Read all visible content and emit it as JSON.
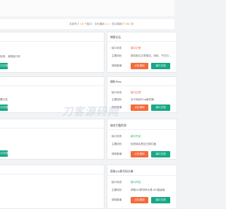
{
  "summary": {
    "prefix": "共发布了",
    "a": "16",
    "mid1": "个接口 · 今日调用",
    "b": "1.2",
    "mid2": "· 总共调用了",
    "c": "462",
    "suffix": "次"
  },
  "watermark": "刀客源码网",
  "labels": {
    "status": "接口状态",
    "use": "主要用处",
    "call": "调用渠道"
  },
  "buttons": {
    "apply": "点击调用",
    "doc": "接口文档"
  },
  "left_texts": {
    "t1": "检测，消费接口来",
    "t2": "署已送"
  },
  "cards": [
    {
      "title": "博客论坛",
      "status": "接口正常",
      "use": "提供各位文章推送、收权、节日日..."
    },
    {
      "title": "随机Ping",
      "status": "接口正常",
      "use": "对于网站Ping服务器"
    },
    {
      "title": "域名拦截检测",
      "status": "接口开启",
      "use": "检查域名是否已被拦截"
    },
    {
      "title": "获取QQ群号码头像",
      "status": "接口开启",
      "use": "获取QQ群号码头像 API高级版"
    }
  ]
}
